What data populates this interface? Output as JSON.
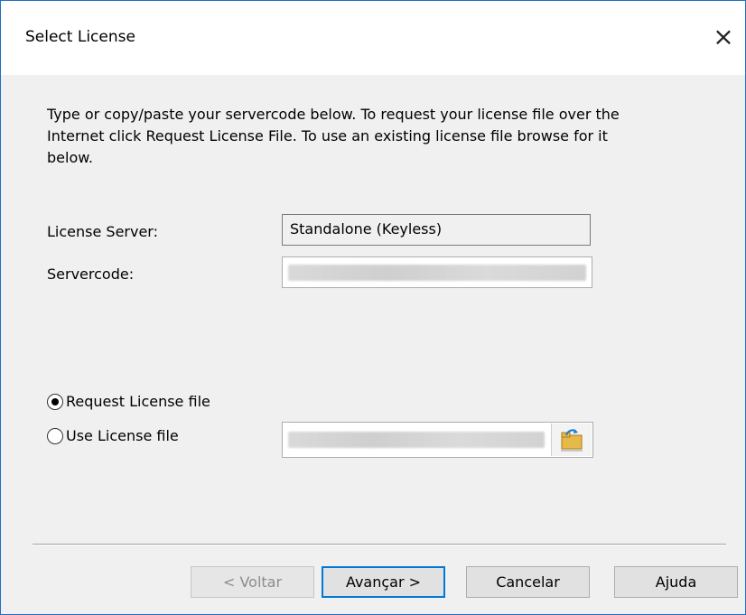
{
  "window": {
    "title": "Select License",
    "close_glyph": "×"
  },
  "instructions": "Type or copy/paste your servercode below. To request your license file over the Internet click Request License File. To use an existing license file browse for it below.",
  "fields": {
    "license_server_label": "License Server:",
    "license_server_value": "Standalone (Keyless)",
    "servercode_label": "Servercode:"
  },
  "options": {
    "request_label": "Request License file",
    "use_label": "Use License file",
    "selected": "request"
  },
  "buttons": {
    "back": "< Voltar",
    "next": "Avançar >",
    "cancel": "Cancelar",
    "help": "Ajuda"
  },
  "colors": {
    "accent": "#0078d7",
    "window_border": "#1e6fc2"
  }
}
